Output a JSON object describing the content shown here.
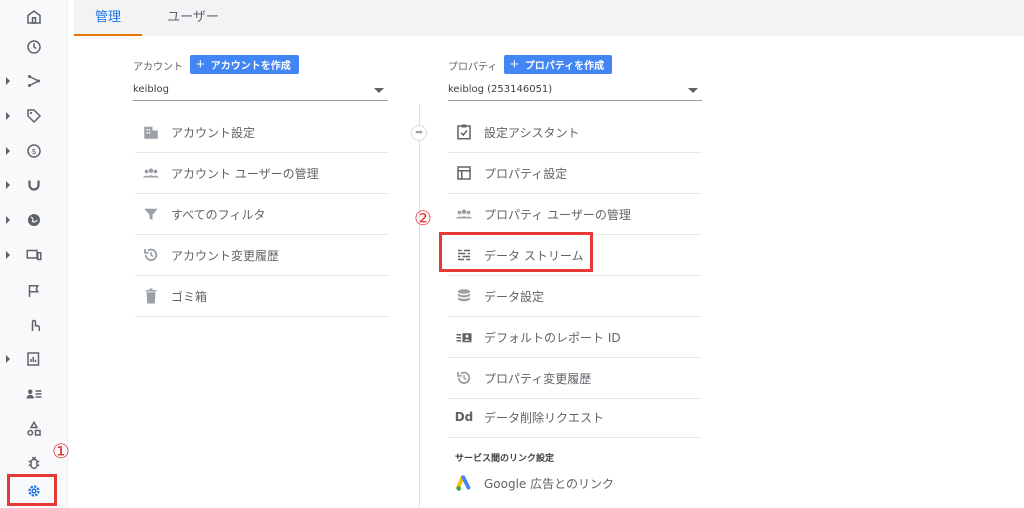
{
  "tabs": [
    {
      "label": "管理",
      "active": true
    },
    {
      "label": "ユーザー",
      "active": false
    }
  ],
  "account": {
    "label": "アカウント",
    "create_label": "アカウントを作成",
    "selected": "keiblog",
    "items": [
      {
        "label": "アカウント設定",
        "icon": "building-icon"
      },
      {
        "label": "アカウント ユーザーの管理",
        "icon": "people-icon"
      },
      {
        "label": "すべてのフィルタ",
        "icon": "filter-icon"
      },
      {
        "label": "アカウント変更履歴",
        "icon": "history-icon"
      },
      {
        "label": "ゴミ箱",
        "icon": "trash-icon"
      }
    ]
  },
  "property": {
    "label": "プロパティ",
    "create_label": "プロパティを作成",
    "selected": "keiblog (253146051)",
    "items": [
      {
        "label": "設定アシスタント",
        "icon": "checklist-icon"
      },
      {
        "label": "プロパティ設定",
        "icon": "layout-icon"
      },
      {
        "label": "プロパティ ユーザーの管理",
        "icon": "people-icon"
      },
      {
        "label": "データ ストリーム",
        "icon": "streams-icon"
      },
      {
        "label": "データ設定",
        "icon": "database-icon"
      },
      {
        "label": "デフォルトのレポート ID",
        "icon": "report-id-icon"
      },
      {
        "label": "プロパティ変更履歴",
        "icon": "history-icon"
      },
      {
        "label": "データ削除リクエスト",
        "icon": "dd-icon"
      }
    ],
    "section_title": "サービス間のリンク設定",
    "link_item": "Google 広告とのリンク"
  },
  "annotations": {
    "one": "①",
    "two": "②",
    "color": "#e53935"
  },
  "dd_text": "Dd",
  "colors": {
    "accent": "#1a73e8",
    "button": "#4285f4",
    "tab_underline": "#e37400"
  }
}
